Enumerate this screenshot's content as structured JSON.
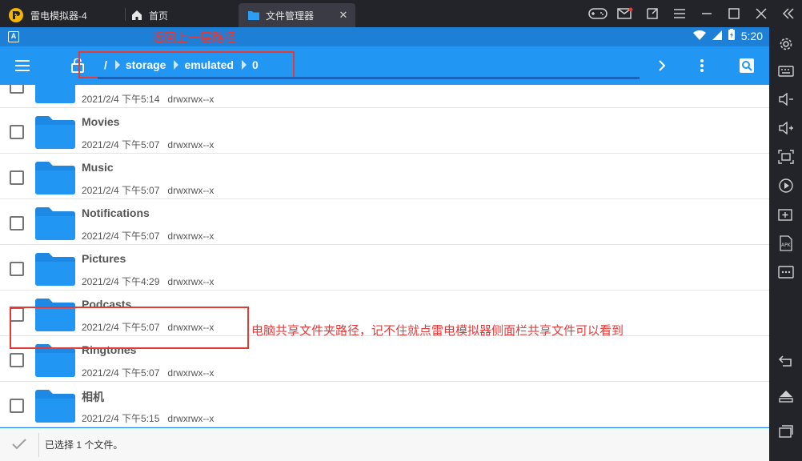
{
  "tabs": {
    "app_title": "雷电模拟器-4",
    "home_label": "首页",
    "files_label": "文件管理器"
  },
  "status": {
    "time": "5:20",
    "annotation": "返回上一层路径"
  },
  "breadcrumb": [
    "/",
    "storage",
    "emulated",
    "0"
  ],
  "files": [
    {
      "name": "",
      "date": "2021/2/4 下午5:14",
      "perm": "drwxrwx--x"
    },
    {
      "name": "Movies",
      "date": "2021/2/4 下午5:07",
      "perm": "drwxrwx--x"
    },
    {
      "name": "Music",
      "date": "2021/2/4 下午5:07",
      "perm": "drwxrwx--x"
    },
    {
      "name": "Notifications",
      "date": "2021/2/4 下午5:07",
      "perm": "drwxrwx--x"
    },
    {
      "name": "Pictures",
      "date": "2021/2/4 下午4:29",
      "perm": "drwxrwx--x"
    },
    {
      "name": "Podcasts",
      "date": "2021/2/4 下午5:07",
      "perm": "drwxrwx--x"
    },
    {
      "name": "Ringtones",
      "date": "2021/2/4 下午5:07",
      "perm": "drwxrwx--x"
    },
    {
      "name": "相机",
      "date": "2021/2/4 下午5:15",
      "perm": "drwxrwx--x"
    }
  ],
  "annotation_pictures": "电脑共享文件夹路径，记不住就点雷电模拟器侧面栏共享文件可以看到",
  "selection_text": "已选择 1 个文件。",
  "colors": {
    "toolbar": "#2196f3",
    "statusbar": "#1e7fd6",
    "folder": "#1e88e5",
    "annotation": "#e23b3b"
  }
}
